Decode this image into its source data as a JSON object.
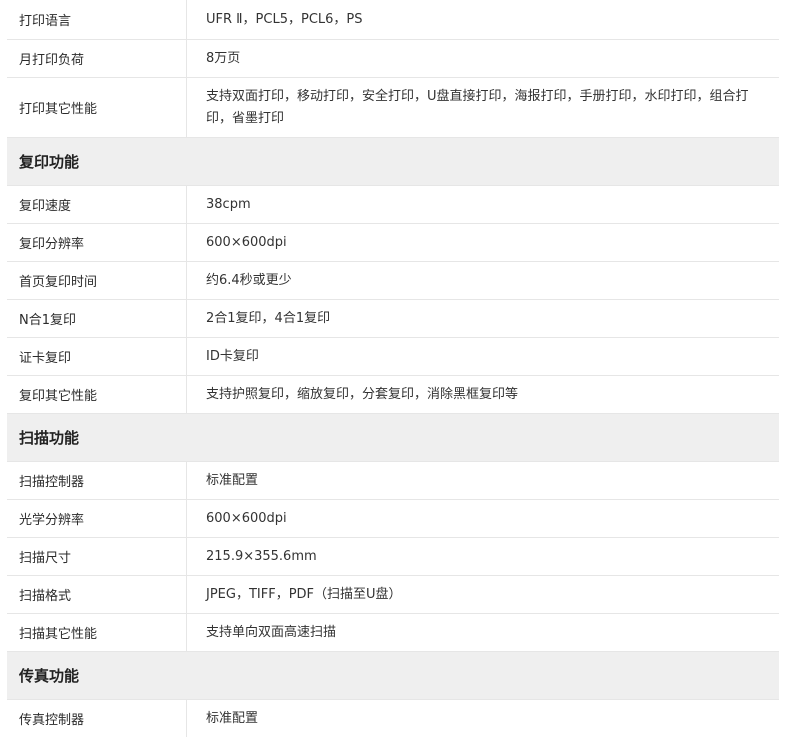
{
  "print": {
    "rows": [
      {
        "label": "打印语言",
        "value": "UFR Ⅱ，PCL5，PCL6，PS"
      },
      {
        "label": "月打印负荷",
        "value": "8万页"
      },
      {
        "label": "打印其它性能",
        "value": "支持双面打印，移动打印，安全打印，U盘直接打印，海报打印，手册打印，水印打印，组合打印，省墨打印"
      }
    ]
  },
  "copy": {
    "title": "复印功能",
    "rows": [
      {
        "label": "复印速度",
        "value": "38cpm"
      },
      {
        "label": "复印分辨率",
        "value": "600×600dpi"
      },
      {
        "label": "首页复印时间",
        "value": "约6.4秒或更少"
      },
      {
        "label": "N合1复印",
        "value": "2合1复印，4合1复印"
      },
      {
        "label": "证卡复印",
        "value": "ID卡复印"
      },
      {
        "label": "复印其它性能",
        "value": "支持护照复印，缩放复印，分套复印，消除黑框复印等"
      }
    ]
  },
  "scan": {
    "title": "扫描功能",
    "rows": [
      {
        "label": "扫描控制器",
        "value": "标准配置"
      },
      {
        "label": "光学分辨率",
        "value": "600×600dpi"
      },
      {
        "label": "扫描尺寸",
        "value": "215.9×355.6mm"
      },
      {
        "label": "扫描格式",
        "value": "JPEG，TIFF，PDF（扫描至U盘）"
      },
      {
        "label": "扫描其它性能",
        "value": "支持单向双面高速扫描"
      }
    ]
  },
  "fax": {
    "title": "传真功能",
    "rows": [
      {
        "label": "传真控制器",
        "value": "标准配置"
      }
    ]
  }
}
